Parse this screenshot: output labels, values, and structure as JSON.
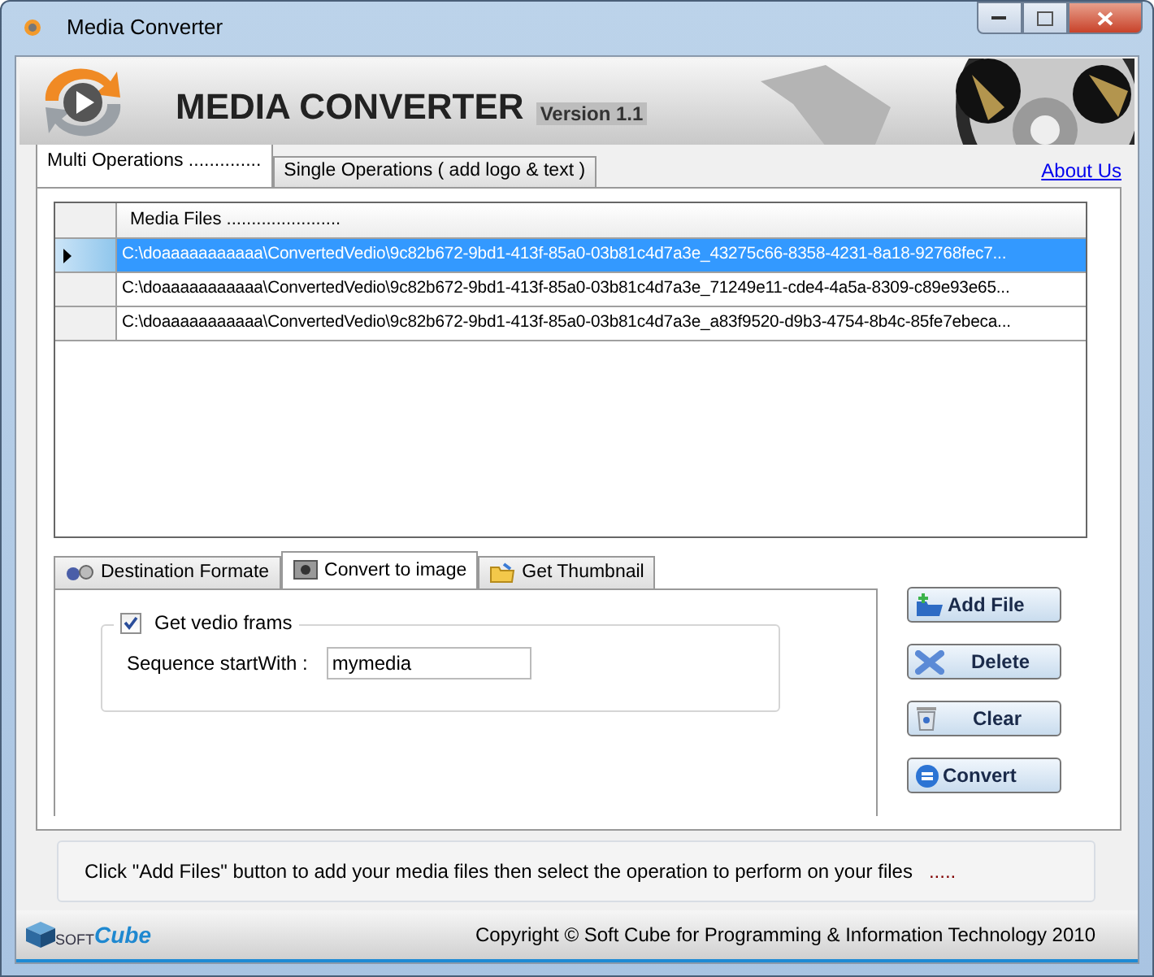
{
  "window": {
    "title": "Media Converter"
  },
  "banner": {
    "title": "MEDIA CONVERTER",
    "version": "Version 1.1"
  },
  "tabs": [
    {
      "label": "Multi Operations ..............",
      "selected": true
    },
    {
      "label": "Single Operations ( add logo & text  )",
      "selected": false
    }
  ],
  "about_link": "About Us",
  "table": {
    "columns": [
      "Media Files ......................."
    ],
    "rows": [
      {
        "selected": true,
        "cells": [
          "C:\\doaaaaaaaaaaa\\ConvertedVedio\\9c82b672-9bd1-413f-85a0-03b81c4d7a3e_43275c66-8358-4231-8a18-92768fec7..."
        ]
      },
      {
        "selected": false,
        "cells": [
          "C:\\doaaaaaaaaaaa\\ConvertedVedio\\9c82b672-9bd1-413f-85a0-03b81c4d7a3e_71249e11-cde4-4a5a-8309-c89e93e65..."
        ]
      },
      {
        "selected": false,
        "cells": [
          "C:\\doaaaaaaaaaaa\\ConvertedVedio\\9c82b672-9bd1-413f-85a0-03b81c4d7a3e_a83f9520-d9b3-4754-8b4c-85fe7ebeca..."
        ]
      }
    ]
  },
  "operation_tabs": [
    {
      "label": "Destination Formate",
      "kind": "format",
      "selected": false
    },
    {
      "label": "Convert to image",
      "kind": "image",
      "selected": true
    },
    {
      "label": "Get Thumbnail",
      "kind": "thumbnail",
      "selected": false
    }
  ],
  "frames": {
    "label": "Get vedio frams",
    "checked": true,
    "field_label": "Sequence startWith :",
    "value": "mymedia"
  },
  "buttons": [
    {
      "label": "Add File",
      "kind": "add"
    },
    {
      "label": "Delete",
      "kind": "delete"
    },
    {
      "label": "Clear",
      "kind": "clear"
    },
    {
      "label": "Convert",
      "kind": "convert"
    }
  ],
  "hint": {
    "text": "Click \"Add Files\" button to add your media files  then select the operation to perform on your files",
    "dots": "....."
  },
  "footer": {
    "logo_top": "SOFT",
    "logo_bottom": "Cube",
    "copyright": "Copyright © Soft Cube for Programming & Information Technology 2010"
  }
}
